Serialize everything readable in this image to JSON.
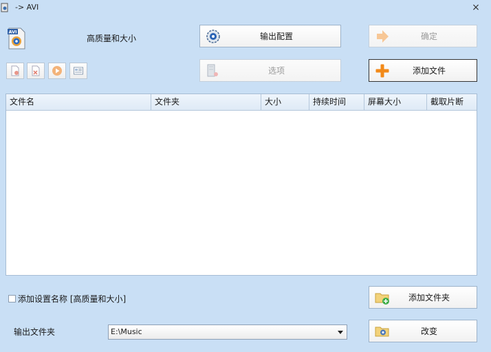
{
  "window": {
    "title": "-> AVI",
    "close_glyph": "×"
  },
  "profile": {
    "name": "高质量和大小"
  },
  "buttons": {
    "output_config": "输出配置",
    "ok": "确定",
    "options": "选项",
    "add_file": "添加文件",
    "add_folder": "添加文件夹",
    "change": "改变"
  },
  "toolbar_icons": [
    "remove-icon",
    "clear-icon",
    "play-icon",
    "info-icon"
  ],
  "table": {
    "columns": [
      "文件名",
      "文件夹",
      "大小",
      "持续时间",
      "屏幕大小",
      "截取片断"
    ],
    "rows": []
  },
  "settings": {
    "add_setting_name_label": "添加设置名称 [高质量和大小]",
    "checked": false
  },
  "output": {
    "label": "输出文件夹",
    "folder": "E:\\Music"
  },
  "colors": {
    "background": "#c9dff5",
    "accent_orange": "#f28a1a",
    "border": "#9cb2c9"
  }
}
